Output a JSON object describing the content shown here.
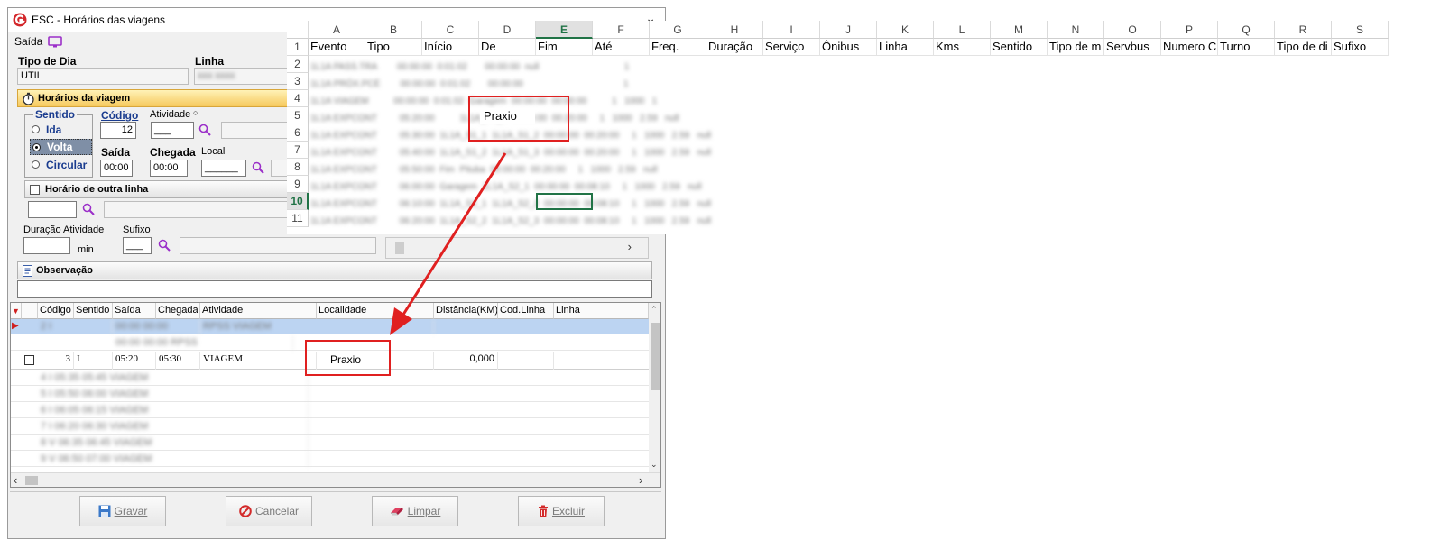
{
  "window": {
    "title": "ESC - Horários das viagens",
    "menu_saida": "Saída"
  },
  "header": {
    "tipo_dia_label": "Tipo de Dia",
    "tipo_dia_value": "UTIL",
    "linha_label": "Linha"
  },
  "horarios": {
    "section_title": "Horários da viagem",
    "sentido_label": "Sentido",
    "ida": "Ida",
    "volta": "Volta",
    "circular": "Circular",
    "codigo_label": "Código",
    "codigo_value": "12",
    "atividade_label": "Atividade",
    "atividade_value": "___",
    "saida_label": "Saída",
    "saida_value": "00:00",
    "chegada_label": "Chegada",
    "chegada_value": "00:00",
    "local_label": "Local",
    "local_value": "______"
  },
  "outra_linha": {
    "label": "Horário de outra linha"
  },
  "duracao": {
    "label": "Duração Atividade",
    "unit": "min",
    "sufixo_label": "Sufixo",
    "sufixo_value": "___"
  },
  "observacao": {
    "label": "Observação"
  },
  "grid": {
    "columns": [
      "Código",
      "Sentido",
      "Saída",
      "Chegada",
      "Atividade",
      "Localidade",
      "Distância(KM)",
      "Cod.Linha",
      "Linha"
    ],
    "highlight_row": {
      "codigo": "3",
      "sentido": "I",
      "saida": "05:20",
      "chegada": "05:30",
      "atividade": "VIAGEM",
      "localidade": "Praxio",
      "distancia": "0,000"
    }
  },
  "buttons": {
    "gravar": "Gravar",
    "cancelar": "Cancelar",
    "limpar": "Limpar",
    "excluir": "Excluir"
  },
  "spreadsheet": {
    "col_letters": [
      "A",
      "B",
      "C",
      "D",
      "E",
      "F",
      "G",
      "H",
      "I",
      "J",
      "K",
      "L",
      "M",
      "N",
      "O",
      "P",
      "Q",
      "R",
      "S"
    ],
    "row_numbers": [
      "1",
      "2",
      "3",
      "4",
      "5",
      "6",
      "7",
      "8",
      "9",
      "10",
      "11"
    ],
    "headers": [
      "Evento",
      "Tipo",
      "Início",
      "De",
      "Fim",
      "Até",
      "Freq.",
      "Duração",
      "Serviço",
      "Ônibus",
      "Linha",
      "Kms",
      "Sentido",
      "Tipo de m",
      "Servbus",
      "Numero C",
      "Turno",
      "Tipo de di",
      "Sufixo"
    ],
    "highlight_cell": "Praxio"
  },
  "colors": {
    "accent_red": "#e02020",
    "selection_blue": "#bcd4f2",
    "section_yellow": "#f6c95e",
    "excel_green": "#217346"
  }
}
